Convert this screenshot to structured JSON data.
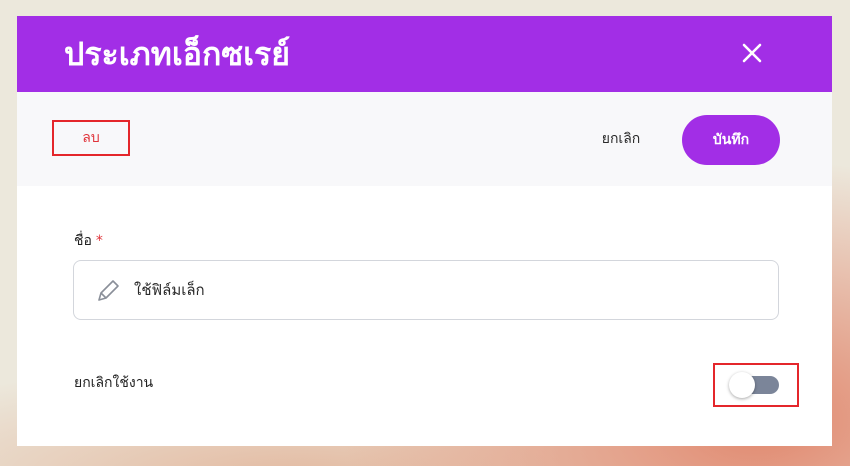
{
  "dialog": {
    "title": "ประเภทเอ็กซเรย์",
    "close_icon": "close-icon",
    "colors": {
      "accent": "#a22ee6",
      "danger": "#e4262b"
    }
  },
  "toolbar": {
    "delete_label": "ลบ",
    "cancel_label": "ยกเลิก",
    "save_label": "บันทึก"
  },
  "form": {
    "name": {
      "label": "ชื่อ",
      "required_mark": "*",
      "value": "ใช้ฟิล์มเล็ก",
      "icon": "pencil-icon"
    },
    "disable": {
      "label": "ยกเลิกใช้งาน",
      "enabled": false
    }
  }
}
